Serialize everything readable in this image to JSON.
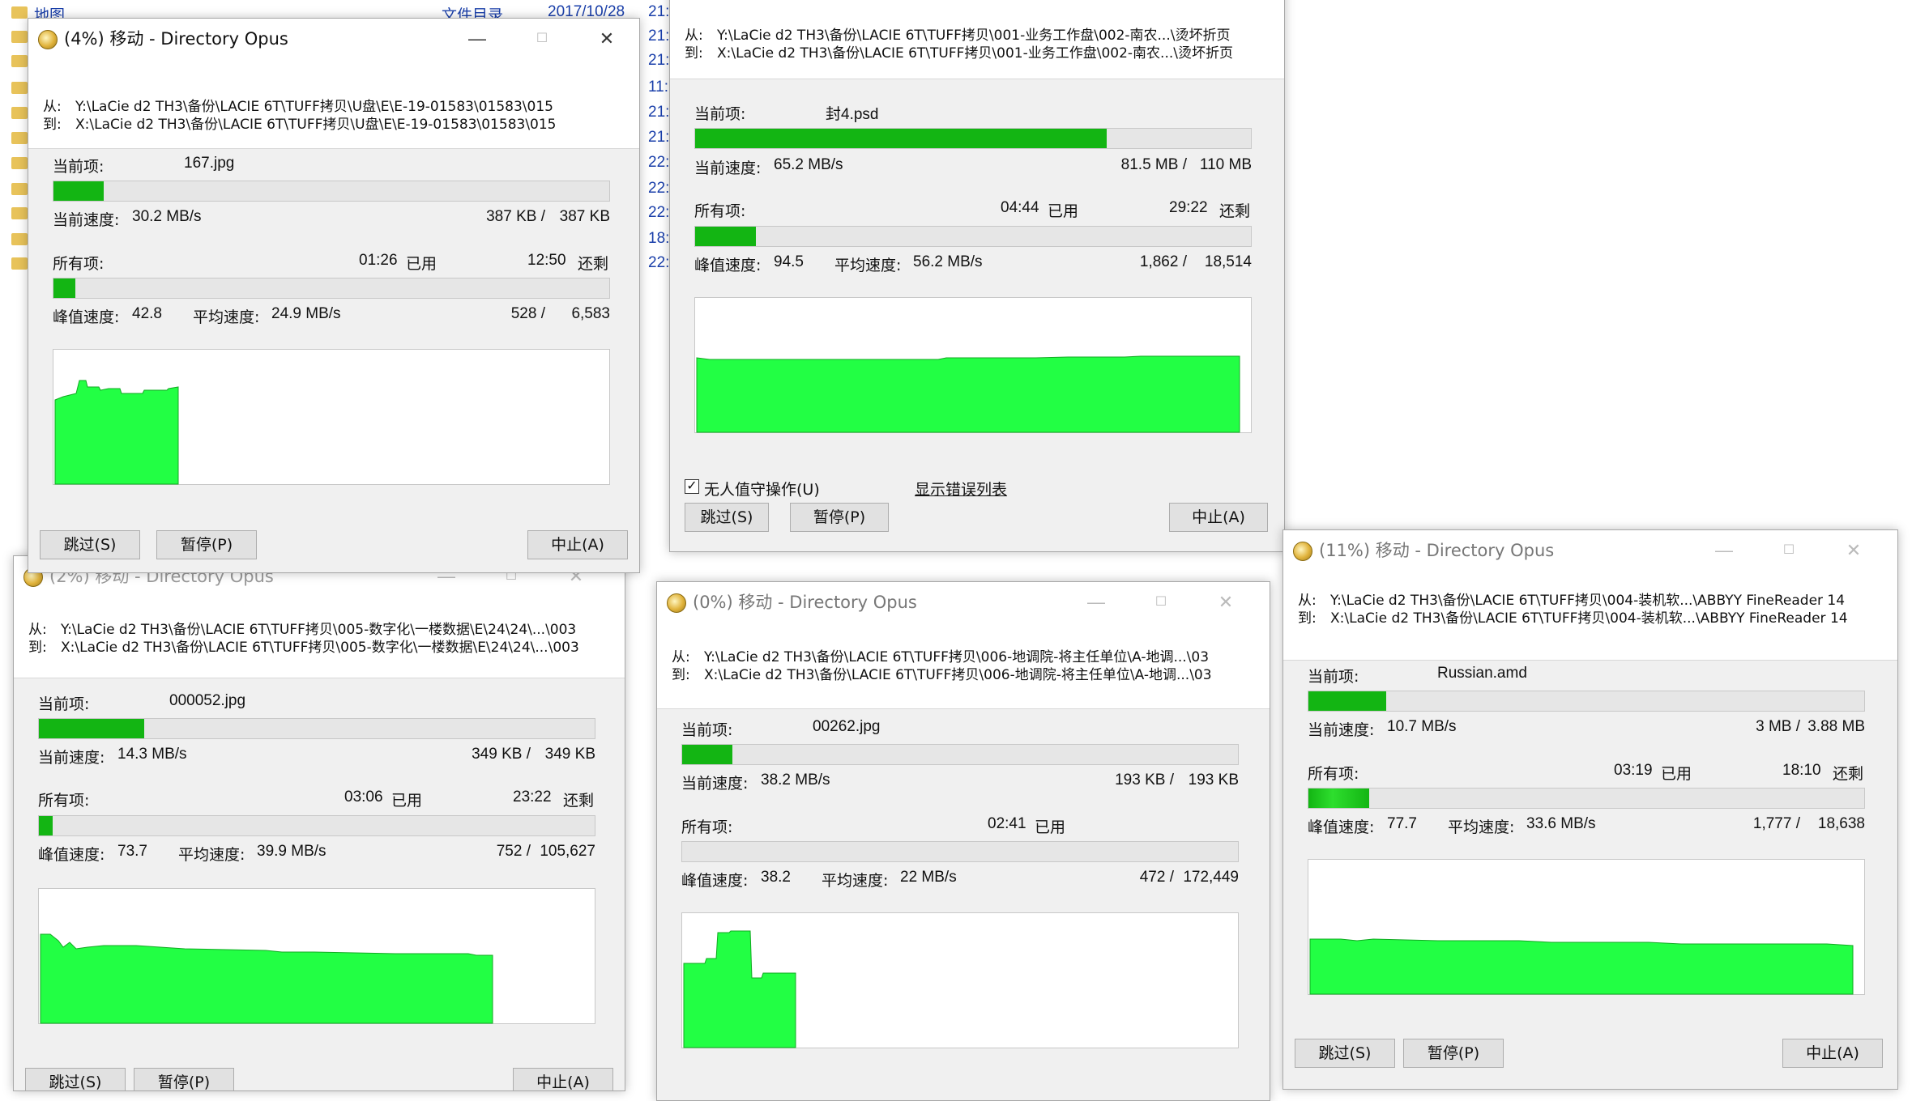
{
  "explorer": {
    "rows": [
      {
        "name": "地图",
        "type": "文件目录",
        "date": "2017/10/28",
        "time": "21:"
      },
      {
        "name": "",
        "type": "",
        "date": "",
        "time": "21:"
      },
      {
        "name": "",
        "type": "",
        "date": "",
        "time": "21:"
      },
      {
        "name": "",
        "type": "",
        "date": "",
        "time": "11:"
      },
      {
        "name": "",
        "type": "",
        "date": "",
        "time": "21:"
      },
      {
        "name": "",
        "type": "",
        "date": "",
        "time": "21:"
      },
      {
        "name": "",
        "type": "",
        "date": "",
        "time": "22:"
      },
      {
        "name": "",
        "type": "",
        "date": "",
        "time": "22:"
      },
      {
        "name": "",
        "type": "",
        "date": "",
        "time": "22:"
      },
      {
        "name": "",
        "type": "",
        "date": "",
        "time": "18:"
      },
      {
        "name": "",
        "type": "",
        "date": "",
        "time": "22:"
      }
    ]
  },
  "labels": {
    "from": "从:",
    "to": "到:",
    "current_item": "当前项:",
    "current_speed": "当前速度:",
    "all_items": "所有项:",
    "peak_speed": "峰值速度:",
    "avg_speed": "平均速度:",
    "used": "已用",
    "remaining": "还剩",
    "skip": "跳过(S)",
    "pause": "暂停(P)",
    "abort": "中止(A)",
    "unattended": "无人值守操作(U)",
    "show_errors": "显示错误列表",
    "minimize": "—",
    "maximize": "☐",
    "close": "✕"
  },
  "dialogs": [
    {
      "title": "(4%) 移动 - Directory Opus",
      "from": "Y:\\LaCie d2 TH3\\备份\\LACIE 6T\\TUFF拷贝\\U盘\\E\\E-19-01583\\01583\\015",
      "to": "X:\\LaCie d2 TH3\\备份\\LACIE 6T\\TUFF拷贝\\U盘\\E\\E-19-01583\\01583\\015",
      "current_item": "167.jpg",
      "current_progress": 0.09,
      "current_speed": "30.2 MB/s",
      "current_done": "387 KB /",
      "current_total": "387 KB",
      "all_used": "01:26",
      "all_remaining": "12:50",
      "all_progress": 0.04,
      "peak": "42.8",
      "avg": "24.9 MB/s",
      "count_done": "528 /",
      "count_total": "6,583"
    },
    {
      "title": "",
      "from": "Y:\\LaCie d2 TH3\\备份\\LACIE 6T\\TUFF拷贝\\001-业务工作盘\\002-南农...\\烫坏折页",
      "to": "X:\\LaCie d2 TH3\\备份\\LACIE 6T\\TUFF拷贝\\001-业务工作盘\\002-南农...\\烫坏折页",
      "current_item": "封4.psd",
      "current_progress": 0.74,
      "current_speed": "65.2 MB/s",
      "current_done": "81.5 MB /",
      "current_total": "110 MB",
      "all_used": "04:44",
      "all_remaining": "29:22",
      "all_progress": 0.11,
      "peak": "94.5",
      "avg": "56.2 MB/s",
      "count_done": "1,862 /",
      "count_total": "18,514"
    },
    {
      "title": "(2%) 移动 - Directory Opus",
      "from": "Y:\\LaCie d2 TH3\\备份\\LACIE 6T\\TUFF拷贝\\005-数字化\\一楼数据\\E\\24\\24\\...\\003",
      "to": "X:\\LaCie d2 TH3\\备份\\LACIE 6T\\TUFF拷贝\\005-数字化\\一楼数据\\E\\24\\24\\...\\003",
      "current_item": "000052.jpg",
      "current_progress": 0.19,
      "current_speed": "14.3 MB/s",
      "current_done": "349 KB /",
      "current_total": "349 KB",
      "all_used": "03:06",
      "all_remaining": "23:22",
      "all_progress": 0.025,
      "peak": "73.7",
      "avg": "39.9 MB/s",
      "count_done": "752 /",
      "count_total": "105,627"
    },
    {
      "title": "(0%) 移动 - Directory Opus",
      "from": "Y:\\LaCie d2 TH3\\备份\\LACIE 6T\\TUFF拷贝\\006-地调院-将主任单位\\A-地调...\\03",
      "to": "X:\\LaCie d2 TH3\\备份\\LACIE 6T\\TUFF拷贝\\006-地调院-将主任单位\\A-地调...\\03",
      "current_item": "00262.jpg",
      "current_progress": 0.09,
      "current_speed": "38.2 MB/s",
      "current_done": "193 KB /",
      "current_total": "193 KB",
      "all_used": "02:41",
      "all_remaining": "",
      "all_progress": 0.0,
      "peak": "38.2",
      "avg": "22 MB/s",
      "count_done": "472 /",
      "count_total": "172,449"
    },
    {
      "title": "(11%) 移动 - Directory Opus",
      "from": "Y:\\LaCie d2 TH3\\备份\\LACIE 6T\\TUFF拷贝\\004-装机软...\\ABBYY FineReader 14",
      "to": "X:\\LaCie d2 TH3\\备份\\LACIE 6T\\TUFF拷贝\\004-装机软...\\ABBYY FineReader 14",
      "current_item": "Russian.amd",
      "current_progress": 0.14,
      "current_speed": "10.7 MB/s",
      "current_done": "3 MB /",
      "current_total": "3.88 MB",
      "all_used": "03:19",
      "all_remaining": "18:10",
      "all_progress": 0.11,
      "peak": "77.7",
      "avg": "33.6 MB/s",
      "count_done": "1,777 /",
      "count_total": "18,638"
    }
  ],
  "colors": {
    "graph_fill": "#22ff44",
    "graph_line": "#11aa22",
    "progress": "#13b513"
  }
}
